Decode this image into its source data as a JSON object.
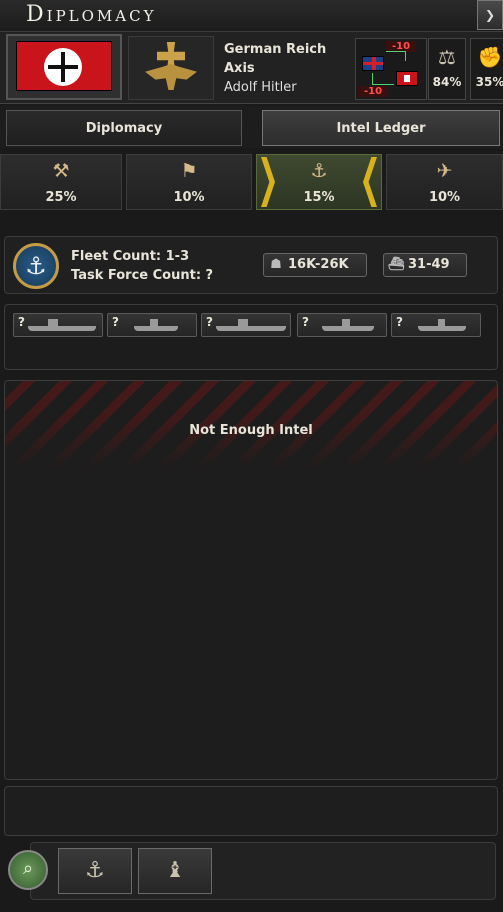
{
  "window": {
    "title": "Diplomacy",
    "corner_glyph": "❯"
  },
  "country": {
    "name": "German Reich",
    "faction": "Axis",
    "leader": "Adolf Hitler"
  },
  "relations": {
    "top_value": "-10",
    "bottom_value": "-10"
  },
  "stats": [
    {
      "icon": "scales-icon",
      "glyph": "⚖",
      "value": "84%"
    },
    {
      "icon": "arm-icon",
      "glyph": "✊",
      "value": "35%"
    }
  ],
  "tabs": [
    {
      "label": "Diplomacy",
      "active": false
    },
    {
      "label": "Intel Ledger",
      "active": true
    }
  ],
  "intel_categories": [
    {
      "icon": "civilian-intel-icon",
      "glyph": "⚒",
      "value": "25%"
    },
    {
      "icon": "army-intel-icon",
      "glyph": "⚑",
      "value": "10%"
    },
    {
      "icon": "navy-intel-icon",
      "glyph": "⚓",
      "value": "15%",
      "active": true
    },
    {
      "icon": "air-intel-icon",
      "glyph": "✈",
      "value": "10%"
    }
  ],
  "fleet": {
    "fleet_count_label": "Fleet Count: 1-3",
    "task_force_label": "Task Force Count: ?",
    "manpower": "16K-26K",
    "ships": "31-49"
  },
  "ship_slots": [
    "?",
    "?",
    "?",
    "?",
    "?"
  ],
  "main": {
    "message": "Not Enough Intel"
  },
  "bottom_buttons": [
    {
      "icon": "anchor-icon",
      "glyph": "⚓"
    },
    {
      "icon": "chess-pieces-icon",
      "glyph": "♝"
    }
  ],
  "colors": {
    "negative": "#ff5050",
    "accent_gold": "#d8b21e",
    "positive": "#4cd26e"
  }
}
